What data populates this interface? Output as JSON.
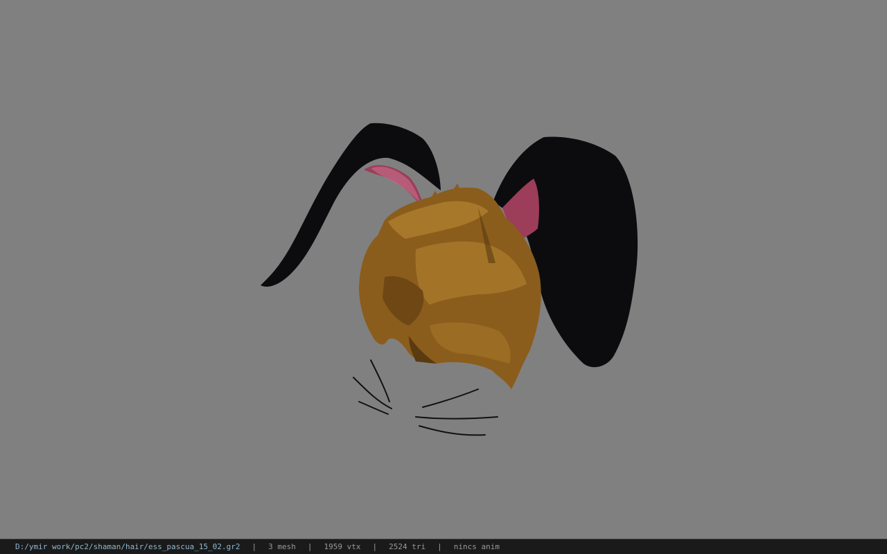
{
  "viewport": {
    "background": "#808080",
    "model_name": "bunny-ears-hair-model"
  },
  "status_bar": {
    "file_path": "D:/ymir work/pc2/shaman/hair/ess_pascua_15_02.gr2",
    "separator": "|",
    "mesh_count": "3 mesh",
    "vertex_count": "1959 vtx",
    "triangle_count": "2524 tri",
    "animation": "nincs anim"
  },
  "colors": {
    "ear_outer": "#0c0c0e",
    "ear_inner": "#9c3d5a",
    "hair_base": "#8a5d1c",
    "hair_light": "#a7782a",
    "hair_dark": "#5a3a10",
    "whisker": "#111111"
  }
}
